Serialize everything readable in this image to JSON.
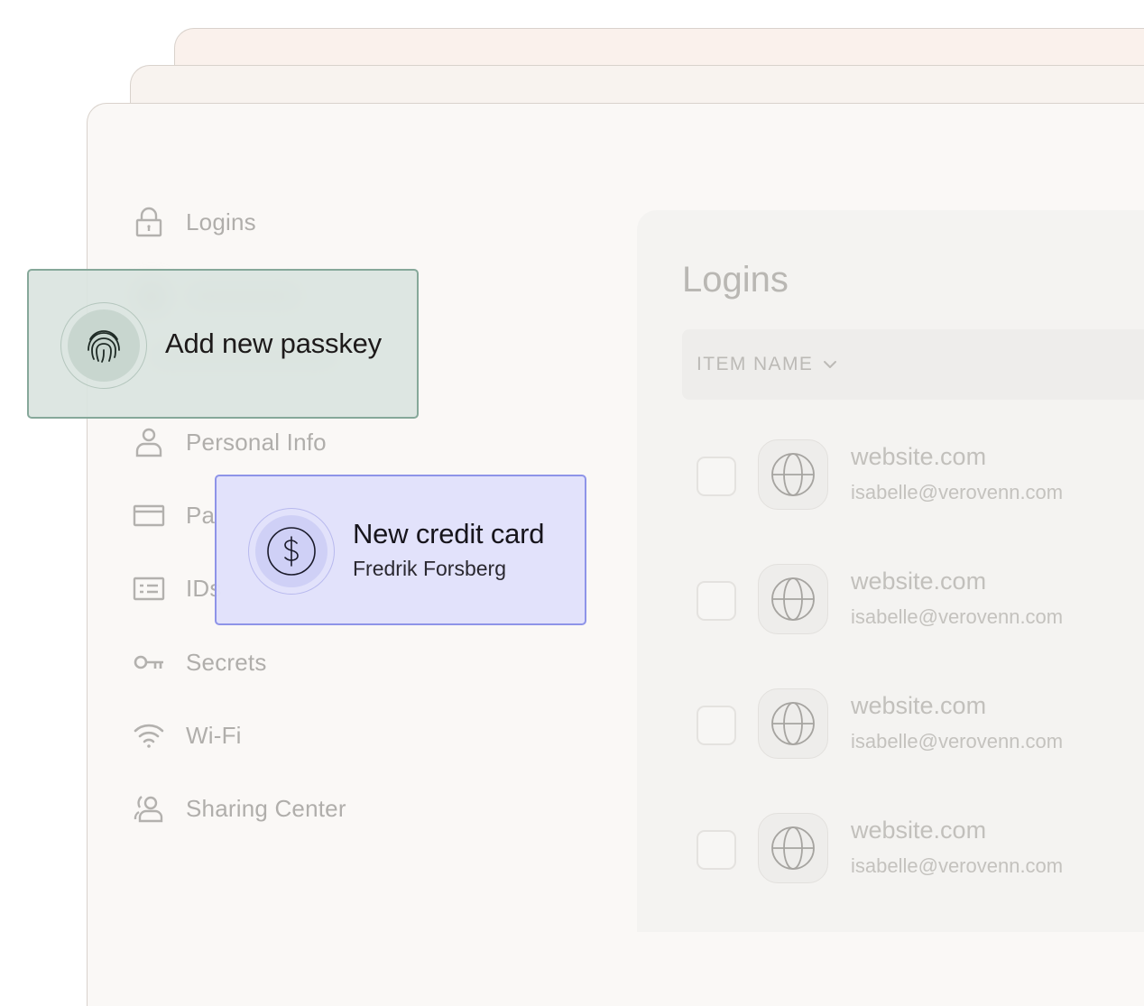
{
  "sidebar": {
    "items": [
      {
        "label": "Logins",
        "icon": "lock-icon"
      },
      {
        "label": "Personal Info",
        "icon": "person-icon"
      },
      {
        "label": "Pa",
        "icon": "card-icon"
      },
      {
        "label": "IDs",
        "icon": "id-card-icon"
      },
      {
        "label": "Secrets",
        "icon": "key-icon"
      },
      {
        "label": "Wi-Fi",
        "icon": "wifi-icon"
      },
      {
        "label": "Sharing Center",
        "icon": "sharing-icon"
      }
    ]
  },
  "main": {
    "title": "Logins",
    "column_header": "ITEM NAME",
    "rows": [
      {
        "site": "website.com",
        "email": "isabelle@verovenn.com"
      },
      {
        "site": "website.com",
        "email": "isabelle@verovenn.com"
      },
      {
        "site": "website.com",
        "email": "isabelle@verovenn.com"
      },
      {
        "site": "website.com",
        "email": "isabelle@verovenn.com"
      }
    ]
  },
  "passkey_card": {
    "label": "Add new passkey",
    "icon": "fingerprint-icon"
  },
  "credit_card_card": {
    "title": "New credit card",
    "subtitle": "Fredrik Forsberg",
    "icon": "dollar-icon"
  },
  "colors": {
    "passkey_bg": "#dae4e0",
    "passkey_border": "#86a89a",
    "credit_card_bg": "#e1e1fb",
    "credit_card_border": "#8e94e8",
    "muted_text": "#b0aeab"
  }
}
